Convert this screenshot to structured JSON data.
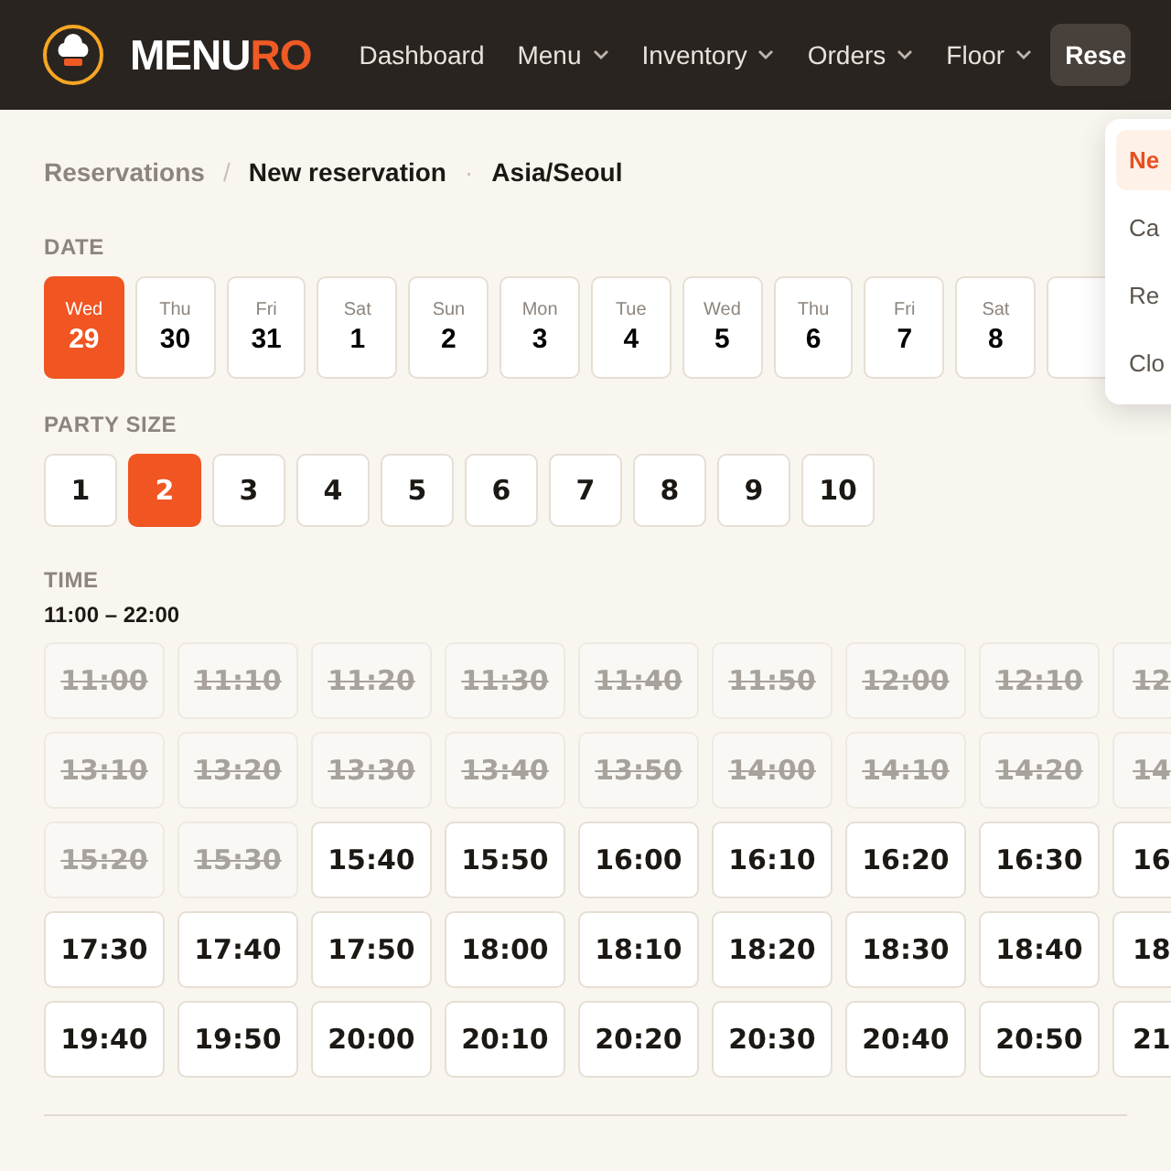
{
  "header": {
    "brand": {
      "main": "MENU",
      "accent": "RO"
    },
    "nav": [
      {
        "label": "Dashboard",
        "has_menu": false,
        "selected": false
      },
      {
        "label": "Menu",
        "has_menu": true,
        "selected": false
      },
      {
        "label": "Inventory",
        "has_menu": true,
        "selected": false
      },
      {
        "label": "Orders",
        "has_menu": true,
        "selected": false
      },
      {
        "label": "Floor",
        "has_menu": true,
        "selected": false
      },
      {
        "label": "Rese",
        "has_menu": false,
        "selected": true
      }
    ]
  },
  "dropdown": {
    "items": [
      {
        "label": "Ne",
        "selected": true
      },
      {
        "label": "Ca",
        "selected": false
      },
      {
        "label": "Re",
        "selected": false
      },
      {
        "label": "Clo",
        "selected": false
      }
    ]
  },
  "breadcrumb": {
    "items": [
      "Reservations",
      "New reservation"
    ],
    "separator": "/",
    "dot": "·",
    "timezone": "Asia/Seoul"
  },
  "date": {
    "label": "DATE",
    "days": [
      {
        "weekday": "Wed",
        "day": "29",
        "selected": true
      },
      {
        "weekday": "Thu",
        "day": "30",
        "selected": false
      },
      {
        "weekday": "Fri",
        "day": "31",
        "selected": false
      },
      {
        "weekday": "Sat",
        "day": "1",
        "selected": false
      },
      {
        "weekday": "Sun",
        "day": "2",
        "selected": false
      },
      {
        "weekday": "Mon",
        "day": "3",
        "selected": false
      },
      {
        "weekday": "Tue",
        "day": "4",
        "selected": false
      },
      {
        "weekday": "Wed",
        "day": "5",
        "selected": false
      },
      {
        "weekday": "Thu",
        "day": "6",
        "selected": false
      },
      {
        "weekday": "Fri",
        "day": "7",
        "selected": false
      },
      {
        "weekday": "Sat",
        "day": "8",
        "selected": false
      }
    ]
  },
  "party_size": {
    "label": "PARTY SIZE",
    "options": [
      {
        "label": "1",
        "selected": false
      },
      {
        "label": "2",
        "selected": true
      },
      {
        "label": "3",
        "selected": false
      },
      {
        "label": "4",
        "selected": false
      },
      {
        "label": "5",
        "selected": false
      },
      {
        "label": "6",
        "selected": false
      },
      {
        "label": "7",
        "selected": false
      },
      {
        "label": "8",
        "selected": false
      },
      {
        "label": "9",
        "selected": false
      },
      {
        "label": "10",
        "selected": false
      }
    ]
  },
  "time": {
    "label": "TIME",
    "hours": "11:00 – 22:00",
    "slots": [
      {
        "label": "11:00",
        "disabled": true
      },
      {
        "label": "11:10",
        "disabled": true
      },
      {
        "label": "11:20",
        "disabled": true
      },
      {
        "label": "11:30",
        "disabled": true
      },
      {
        "label": "11:40",
        "disabled": true
      },
      {
        "label": "11:50",
        "disabled": true
      },
      {
        "label": "12:00",
        "disabled": true
      },
      {
        "label": "12:10",
        "disabled": true
      },
      {
        "label": "12",
        "disabled": true
      },
      {
        "label": "13:10",
        "disabled": true
      },
      {
        "label": "13:20",
        "disabled": true
      },
      {
        "label": "13:30",
        "disabled": true
      },
      {
        "label": "13:40",
        "disabled": true
      },
      {
        "label": "13:50",
        "disabled": true
      },
      {
        "label": "14:00",
        "disabled": true
      },
      {
        "label": "14:10",
        "disabled": true
      },
      {
        "label": "14:20",
        "disabled": true
      },
      {
        "label": "14",
        "disabled": true
      },
      {
        "label": "15:20",
        "disabled": true
      },
      {
        "label": "15:30",
        "disabled": true
      },
      {
        "label": "15:40",
        "disabled": false
      },
      {
        "label": "15:50",
        "disabled": false
      },
      {
        "label": "16:00",
        "disabled": false
      },
      {
        "label": "16:10",
        "disabled": false
      },
      {
        "label": "16:20",
        "disabled": false
      },
      {
        "label": "16:30",
        "disabled": false
      },
      {
        "label": "16",
        "disabled": false
      },
      {
        "label": "17:30",
        "disabled": false
      },
      {
        "label": "17:40",
        "disabled": false
      },
      {
        "label": "17:50",
        "disabled": false
      },
      {
        "label": "18:00",
        "disabled": false
      },
      {
        "label": "18:10",
        "disabled": false
      },
      {
        "label": "18:20",
        "disabled": false
      },
      {
        "label": "18:30",
        "disabled": false
      },
      {
        "label": "18:40",
        "disabled": false
      },
      {
        "label": "18",
        "disabled": false
      },
      {
        "label": "19:40",
        "disabled": false
      },
      {
        "label": "19:50",
        "disabled": false
      },
      {
        "label": "20:00",
        "disabled": false
      },
      {
        "label": "20:10",
        "disabled": false
      },
      {
        "label": "20:20",
        "disabled": false
      },
      {
        "label": "20:30",
        "disabled": false
      },
      {
        "label": "20:40",
        "disabled": false
      },
      {
        "label": "20:50",
        "disabled": false
      },
      {
        "label": "21",
        "disabled": false
      }
    ]
  }
}
